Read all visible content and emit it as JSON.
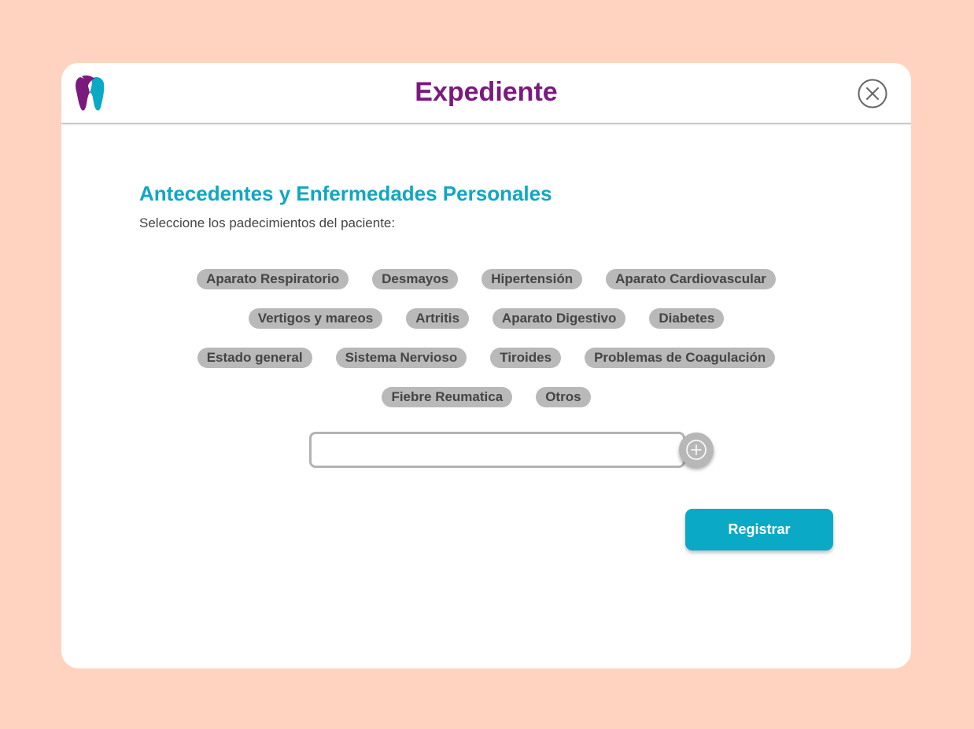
{
  "header": {
    "title": "Expediente",
    "logo_icon": "tooth-logo-icon",
    "close_icon": "close-circle-icon"
  },
  "section": {
    "title": "Antecedentes y Enfermedades Personales",
    "subtitle": "Seleccione los padecimientos del paciente:"
  },
  "conditions": [
    "Aparato Respiratorio",
    "Desmayos",
    "Hipertensión",
    "Aparato Cardiovascular",
    "Vertigos y mareos",
    "Artritis",
    "Aparato Digestivo",
    "Diabetes",
    "Estado general",
    "Sistema Nervioso",
    "Tiroides",
    "Problemas de Coagulación",
    "Fiebre Reumatica",
    "Otros"
  ],
  "custom_condition": {
    "value": "",
    "add_icon": "plus-circle-icon"
  },
  "actions": {
    "register_label": "Registrar"
  },
  "colors": {
    "background": "#ffd3bf",
    "title": "#7b1a7e",
    "accent": "#0aa9c6",
    "chip": "#b9b9b9"
  }
}
